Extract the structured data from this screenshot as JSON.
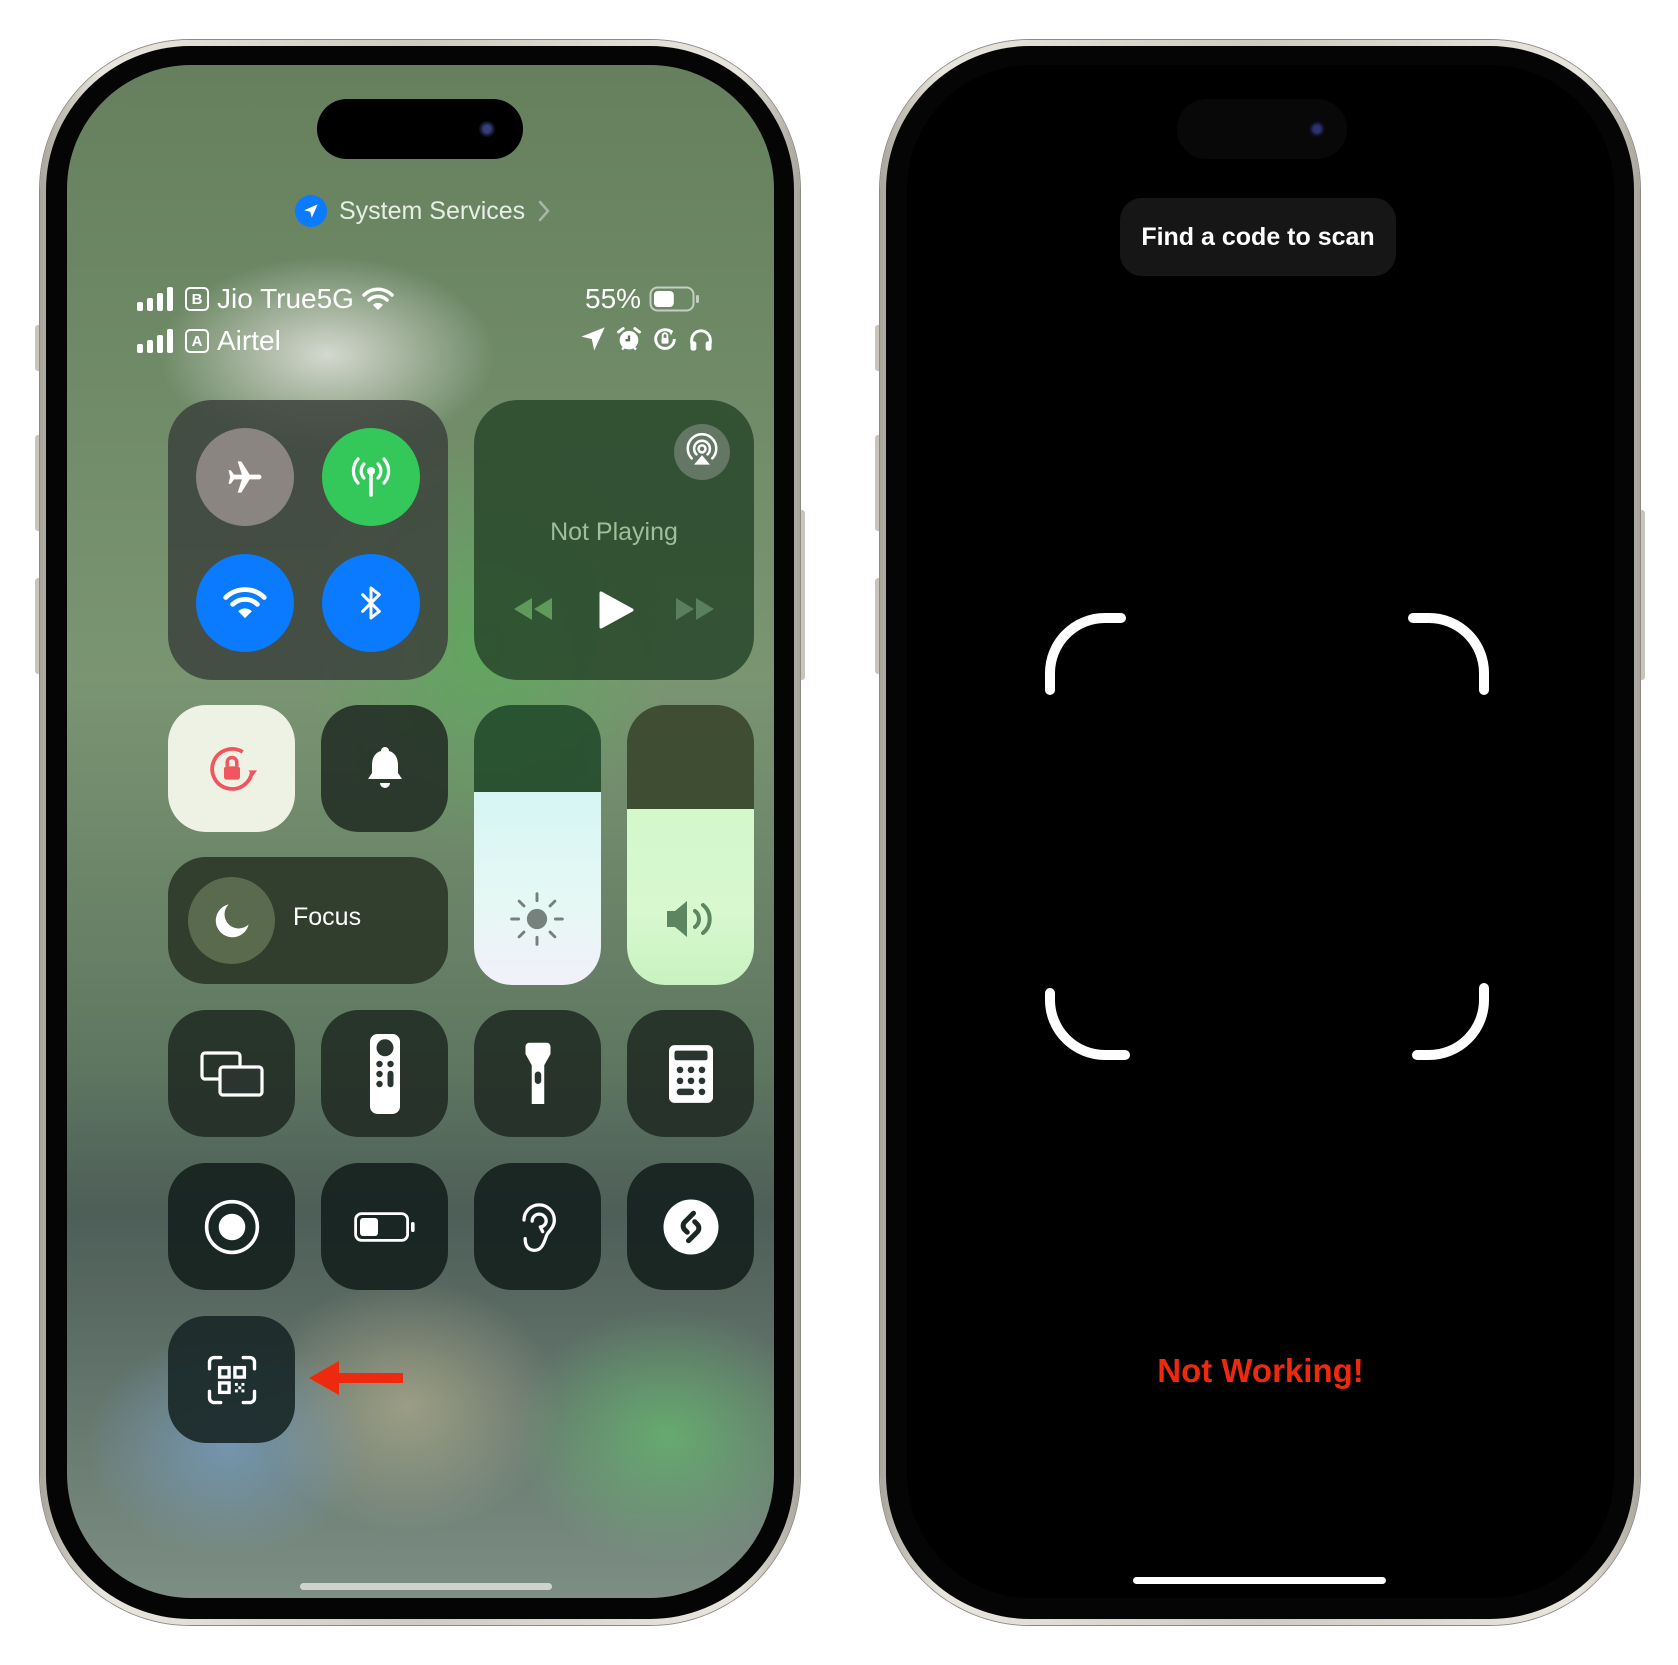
{
  "left_phone": {
    "location_banner": {
      "icon": "location-arrow-icon",
      "label": "System Services",
      "chevron": "chevron-right-icon"
    },
    "status_bar": {
      "sim1": {
        "badge": "B",
        "carrier": "Jio True5G",
        "signal_bars": 4,
        "wifi_icon": "wifi-icon"
      },
      "sim2": {
        "badge": "A",
        "carrier": "Airtel",
        "signal_bars": 4
      },
      "battery_percent": "55%",
      "battery_level": 0.55,
      "indicator_icons": [
        "location-icon",
        "alarm-icon",
        "orientation-lock-icon",
        "headphones-icon"
      ]
    },
    "control_center": {
      "connectivity": [
        {
          "name": "airplane-mode",
          "icon": "airplane-icon",
          "state": "off",
          "color": "#8a8580"
        },
        {
          "name": "cellular-data",
          "icon": "antenna-icon",
          "state": "on",
          "color": "#34c759"
        },
        {
          "name": "wifi",
          "icon": "wifi-icon",
          "state": "on",
          "color": "#0a7aff"
        },
        {
          "name": "bluetooth",
          "icon": "bluetooth-icon",
          "state": "on",
          "color": "#0a7aff"
        }
      ],
      "media": {
        "title": "Not Playing",
        "airplay_icon": "airplay-audio-icon",
        "controls": [
          "rewind-icon",
          "play-icon",
          "fast-forward-icon"
        ]
      },
      "orientation_lock": {
        "icon": "orientation-lock-icon",
        "state": "on",
        "accent": "#f0545c"
      },
      "silent_mode": {
        "icon": "bell-icon",
        "state": "off"
      },
      "focus": {
        "icon": "moon-icon",
        "label": "Focus"
      },
      "brightness": {
        "icon": "sun-icon",
        "level": 0.69
      },
      "volume": {
        "icon": "speaker-icon",
        "level": 0.63
      },
      "grid_row_1": [
        {
          "name": "screen-mirroring",
          "icon": "screen-mirroring-icon"
        },
        {
          "name": "apple-tv-remote",
          "icon": "remote-icon"
        },
        {
          "name": "flashlight",
          "icon": "flashlight-icon"
        },
        {
          "name": "calculator",
          "icon": "calculator-icon"
        }
      ],
      "grid_row_2": [
        {
          "name": "screen-recording",
          "icon": "record-icon"
        },
        {
          "name": "low-power-mode",
          "icon": "battery-icon"
        },
        {
          "name": "hearing",
          "icon": "ear-icon"
        },
        {
          "name": "shazam",
          "icon": "shazam-icon"
        }
      ],
      "code_scanner": {
        "name": "code-scanner",
        "icon": "qr-code-icon"
      },
      "annotation_arrow_color": "#ee2a0e"
    }
  },
  "right_phone": {
    "hint": "Find a code to scan",
    "viewfinder_icon": "viewfinder-brackets",
    "annotation": {
      "text": "Not Working!",
      "color": "#ee2a0e"
    }
  }
}
